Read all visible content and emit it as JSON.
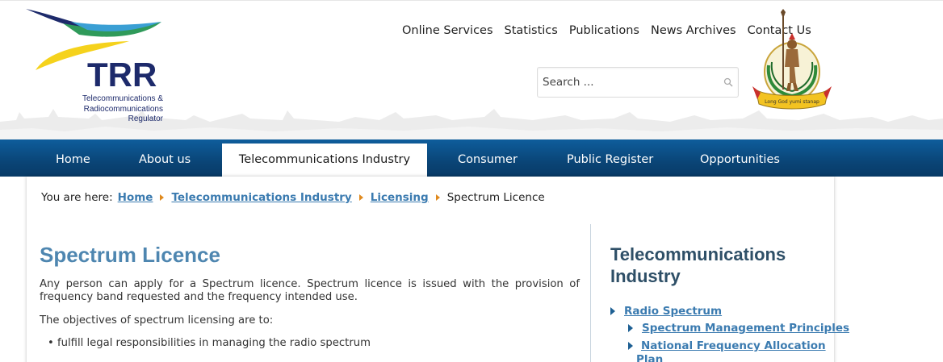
{
  "logo": {
    "acronym": "TRR",
    "subtitle_lines": [
      "Telecommunications &",
      "Radiocommunications",
      "Regulator"
    ]
  },
  "top_nav": [
    "Online Services",
    "Statistics",
    "Publications",
    "News Archives",
    "Contact Us"
  ],
  "search": {
    "placeholder": "Search ..."
  },
  "emblem": {
    "motto": "Long God yumi stanap"
  },
  "main_nav": {
    "home": "Home",
    "about": "About us",
    "telecom": "Telecommunications Industry",
    "consumer": "Consumer",
    "register": "Public Register",
    "opportunities": "Opportunities"
  },
  "breadcrumb": {
    "prefix": "You are here:",
    "items": [
      "Home",
      "Telecommunications Industry",
      "Licensing"
    ],
    "current": "Spectrum Licence"
  },
  "article": {
    "title": "Spectrum Licence",
    "para1": "Any person can apply for a Spectrum licence. Spectrum licence is issued  with the provision of frequency band requested and the frequency intended use.",
    "para2": "The objectives of spectrum licensing are to:",
    "bullets": [
      "fulfill legal responsibilities in managing the radio spectrum"
    ]
  },
  "sidebar": {
    "title": "Telecommunications Industry",
    "links": {
      "radio": "Radio Spectrum",
      "principles": "Spectrum Management Principles",
      "nfap": "National Frequency Allocation",
      "nfap2": "Plan"
    }
  },
  "colors": {
    "nav_blue": "#0a4577",
    "title_blue": "#4e86b0",
    "link_blue": "#3b7bb0",
    "breadcrumb_arrow": "#e08a1e"
  }
}
